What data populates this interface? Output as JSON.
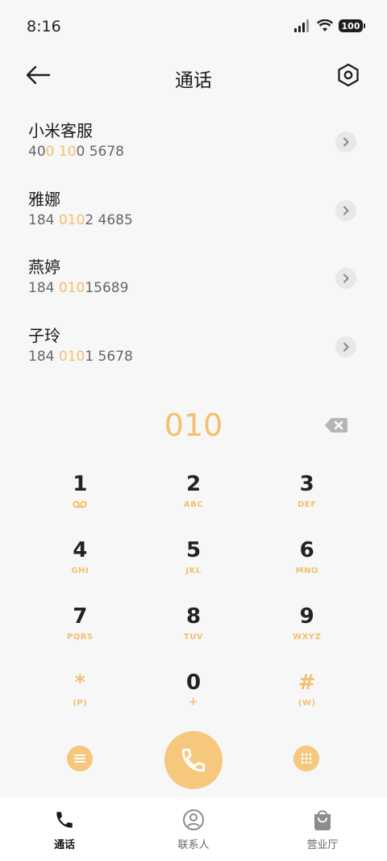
{
  "status_bar": {
    "time": "8:16",
    "battery": "100"
  },
  "header": {
    "title": "通话"
  },
  "results": [
    {
      "name": "小米客服",
      "number_parts": [
        "40",
        "0 10",
        "0 5678"
      ]
    },
    {
      "name": "雅娜",
      "number_parts": [
        "184 ",
        "010",
        "2 4685"
      ]
    },
    {
      "name": "燕婷",
      "number_parts": [
        "184 ",
        "010",
        "15689"
      ]
    },
    {
      "name": "子玲",
      "number_parts": [
        "184 ",
        "010",
        "1 5678"
      ]
    }
  ],
  "dialer": {
    "input": "010"
  },
  "keypad": [
    [
      {
        "digit": "1",
        "letters": "voicemail-icon"
      },
      {
        "digit": "2",
        "letters": "ABC"
      },
      {
        "digit": "3",
        "letters": "DEF"
      }
    ],
    [
      {
        "digit": "4",
        "letters": "GHI"
      },
      {
        "digit": "5",
        "letters": "JKL"
      },
      {
        "digit": "6",
        "letters": "MNO"
      }
    ],
    [
      {
        "digit": "7",
        "letters": "PQRS"
      },
      {
        "digit": "8",
        "letters": "TUV"
      },
      {
        "digit": "9",
        "letters": "WXYZ"
      }
    ],
    [
      {
        "digit": "*",
        "letters": "(P)"
      },
      {
        "digit": "0",
        "letters": "+"
      },
      {
        "digit": "#",
        "letters": "(W)"
      }
    ]
  ],
  "tabs": [
    {
      "label": "通话",
      "icon": "phone-icon",
      "active": true
    },
    {
      "label": "联系人",
      "icon": "contacts-icon",
      "active": false
    },
    {
      "label": "营业厅",
      "icon": "shop-bag-icon",
      "active": false
    }
  ],
  "colors": {
    "accent": "#f2c06f",
    "button": "#f5c87d",
    "background": "#f7f7f7"
  }
}
